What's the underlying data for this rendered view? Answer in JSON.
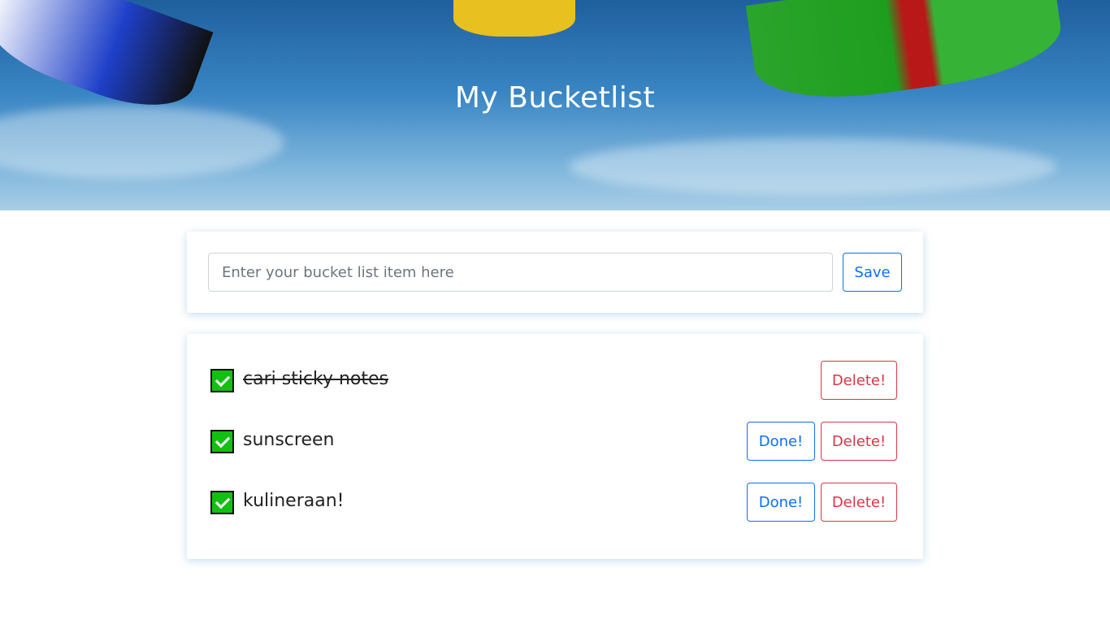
{
  "header": {
    "title": "My Bucketlist"
  },
  "form": {
    "placeholder": "Enter your bucket list item here",
    "value": "",
    "save_label": "Save"
  },
  "items": [
    {
      "text": "cari sticky notes",
      "checked": true,
      "completed": true,
      "delete_label": "Delete!"
    },
    {
      "text": "sunscreen",
      "checked": true,
      "completed": false,
      "done_label": "Done!",
      "delete_label": "Delete!"
    },
    {
      "text": "kulineraan!",
      "checked": true,
      "completed": false,
      "done_label": "Done!",
      "delete_label": "Delete!"
    }
  ],
  "colors": {
    "primary": "#0d6efd",
    "danger": "#dc3545",
    "checkbox": "#11c011"
  }
}
